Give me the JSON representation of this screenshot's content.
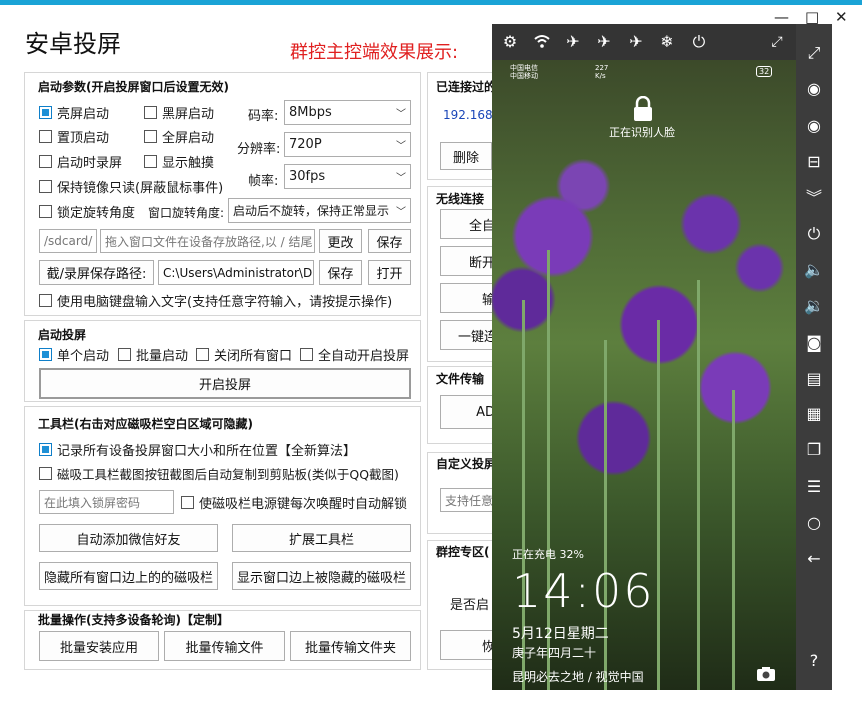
{
  "window": {
    "title": "安卓投屏",
    "overlay_title": "群控主控端效果展示:",
    "controls": {
      "minimize": "—",
      "maximize": "□",
      "close": "✕"
    }
  },
  "startup": {
    "title": "启动参数(开启投屏窗口后设置无效)",
    "checkboxes": {
      "bright": {
        "label": "亮屏启动",
        "checked": true
      },
      "black": {
        "label": "黑屏启动",
        "checked": false
      },
      "top": {
        "label": "置顶启动",
        "checked": false
      },
      "fullscreen": {
        "label": "全屏启动",
        "checked": false
      },
      "record": {
        "label": "启动时录屏",
        "checked": false
      },
      "touch": {
        "label": "显示触摸",
        "checked": false
      },
      "readonly": {
        "label": "保持镜像只读(屏蔽鼠标事件)",
        "checked": false
      },
      "lockrot": {
        "label": "锁定旋转角度",
        "checked": false
      }
    },
    "bitrate_label": "码率:",
    "bitrate_value": "8Mbps",
    "resolution_label": "分辨率:",
    "resolution_value": "720P",
    "fps_label": "帧率:",
    "fps_value": "30fps",
    "rotation_label": "窗口旋转角度:",
    "rotation_value": "启动后不旋转，保持正常显示",
    "device_path": "/sdcard/",
    "drop_placeholder": "拖入窗口文件在设备存放路径,以 / 结尾",
    "change_btn": "更改",
    "save_btn": "保存",
    "capture_btn": "截/录屏保存路径:",
    "capture_path": "C:\\Users\\Administrator\\D",
    "save_btn2": "保存",
    "open_btn": "打开",
    "keyboard": {
      "label": "使用电脑键盘输入文字(支持任意字符输入，请按提示操作)",
      "checked": false
    }
  },
  "launch": {
    "title": "启动投屏",
    "single": {
      "label": "单个启动",
      "checked": true
    },
    "batch": {
      "label": "批量启动",
      "checked": false
    },
    "closeall": {
      "label": "关闭所有窗口",
      "checked": false
    },
    "auto": {
      "label": "全自动开启投屏",
      "checked": false
    },
    "start_btn": "开启投屏"
  },
  "toolbar": {
    "title": "工具栏(右击对应磁吸栏空白区域可隐藏)",
    "remember": {
      "label": "记录所有设备投屏窗口大小和所在位置【全新算法】",
      "checked": true
    },
    "clip": {
      "label": "磁吸工具栏截图按钮截图后自动复制到剪贴板(类似于QQ截图)",
      "checked": false
    },
    "lock_placeholder": "在此填入锁屏密码",
    "unlock": {
      "label": "使磁吸栏电源键每次唤醒时自动解锁",
      "checked": false
    },
    "wechat_btn": "自动添加微信好友",
    "extend_btn": "扩展工具栏",
    "hide_btn": "隐藏所有窗口边上的的磁吸栏",
    "show_btn": "显示窗口边上被隐藏的磁吸栏"
  },
  "batchops": {
    "title": "批量操作(支持多设备轮询)【定制】",
    "install_btn": "批量安装应用",
    "file_btn": "批量传输文件",
    "folder_btn": "批量传输文件夹"
  },
  "right": {
    "connected_title": "已连接过的",
    "ip_partial": "192.168.",
    "delete_btn": "删除",
    "wireless_title": "无线连接",
    "w_btn1": "全自",
    "w_btn2": "断开",
    "w_btn3": "输",
    "w_btn4": "一键连",
    "file_title": "文件传输",
    "file_btn": "AD",
    "custom_title": "自定义投屏",
    "custom_placeholder": "支持任意",
    "group_title": "群控专区(",
    "group_text": "是否启",
    "group_btn": "恢"
  },
  "phone": {
    "status_carrier": "中国电信",
    "status_carrier2": "中国移动",
    "status_speed": "227",
    "status_speed_unit": "K/s",
    "battery": "32",
    "face_text": "正在识别人脸",
    "charging": "正在充电 32%",
    "time": "14:06",
    "date": "5月12日星期二",
    "lunar": "庚子年四月二十",
    "caption": "昆明必去之地 / 视觉中国"
  },
  "colors": {
    "accent": "#1aa3d6",
    "overlay_red": "#e02020",
    "link_blue": "#1a46b8",
    "checkbox_on": "#1e90d6",
    "phone_bar": "#343434"
  },
  "icons": {
    "phone_toolbar": [
      "settings-icon",
      "wifi-icon",
      "airplane-icon",
      "airplane-icon",
      "airplane-icon",
      "snowflake-icon",
      "power-icon",
      "rotate-icon"
    ],
    "side_bar": [
      "expand-icon",
      "eye-icon",
      "eye-icon",
      "minus-square-icon",
      "double-chevron-down-icon",
      "power-icon",
      "volume-up-icon",
      "volume-down-icon",
      "camera-icon",
      "copy-icon",
      "files-icon",
      "windows-icon",
      "menu-icon",
      "circle-icon",
      "back-icon",
      "help-icon"
    ]
  }
}
